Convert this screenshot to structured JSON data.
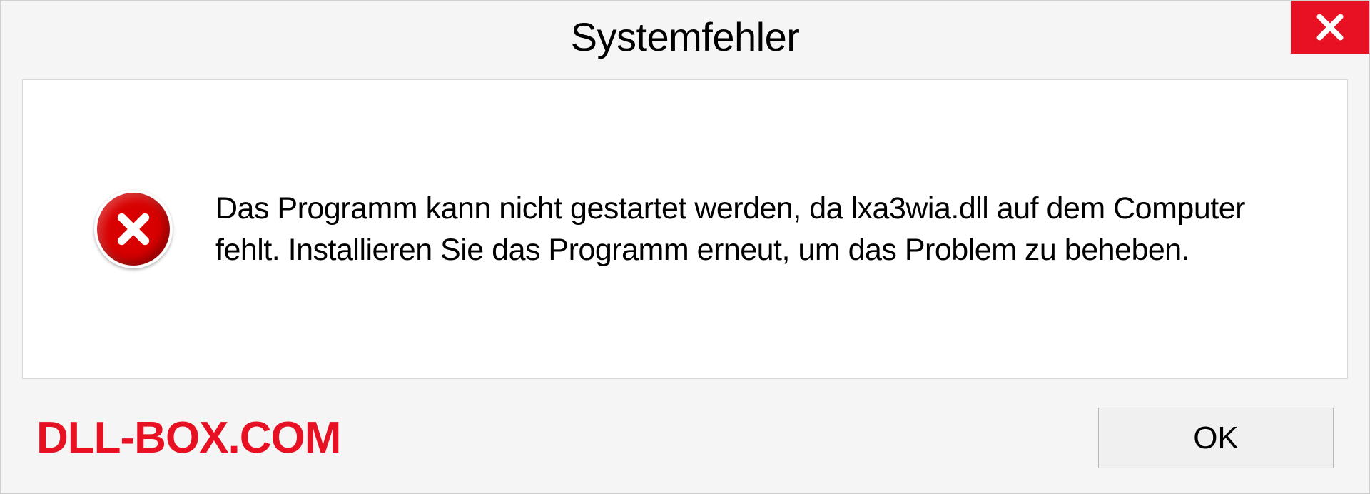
{
  "dialog": {
    "title": "Systemfehler",
    "message": "Das Programm kann nicht gestartet werden, da lxa3wia.dll auf dem Computer fehlt. Installieren Sie das Programm erneut, um das Problem zu beheben.",
    "ok_label": "OK"
  },
  "watermark": "DLL-BOX.COM",
  "colors": {
    "close_bg": "#e81123",
    "error_icon_bg": "#d80000",
    "watermark_color": "#e81123"
  }
}
